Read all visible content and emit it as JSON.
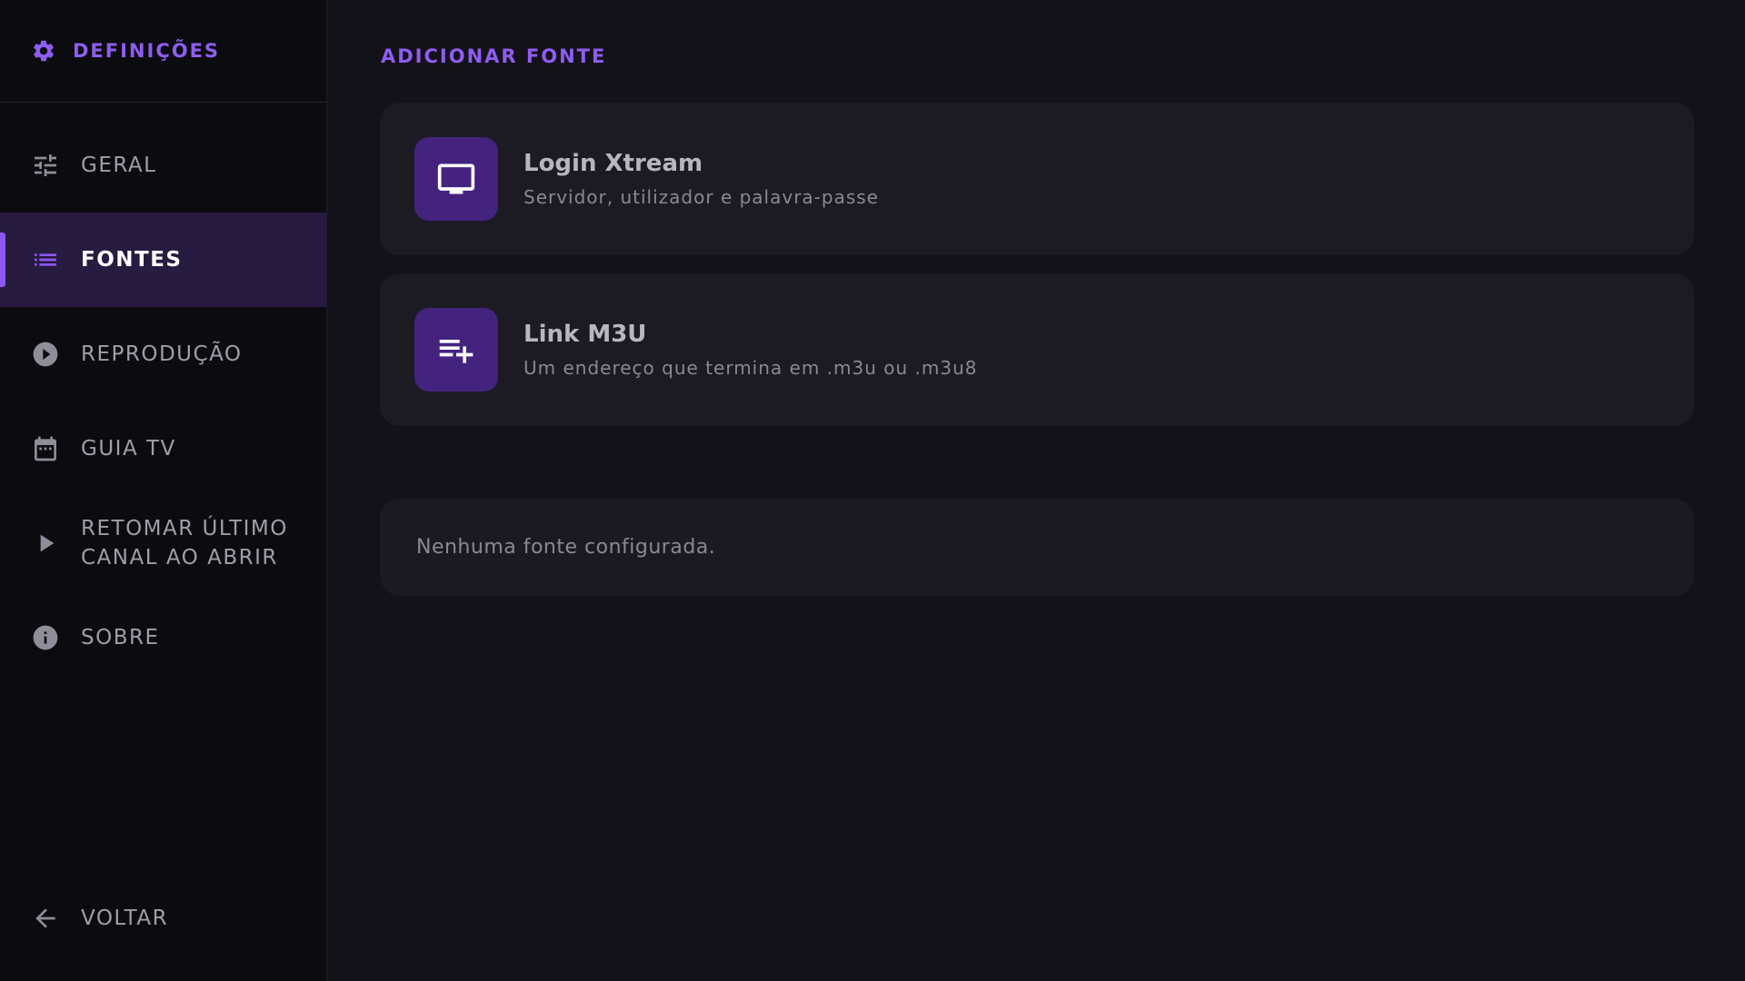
{
  "sidebar": {
    "title": "DEFINIÇÕES",
    "items": [
      {
        "label": "GERAL",
        "icon": "tune-icon"
      },
      {
        "label": "FONTES",
        "icon": "list-icon",
        "active": true
      },
      {
        "label": "REPRODUÇÃO",
        "icon": "play-circle-icon"
      },
      {
        "label": "GUIA TV",
        "icon": "calendar-icon"
      },
      {
        "label_line1": "RETOMAR ÚLTIMO",
        "label_line2": "CANAL AO ABRIR",
        "icon": "play-arrow-icon"
      },
      {
        "label": "SOBRE",
        "icon": "info-icon"
      }
    ],
    "back": {
      "label": "VOLTAR",
      "icon": "arrow-back-icon"
    }
  },
  "main": {
    "section_title": "ADICIONAR FONTE",
    "cards": [
      {
        "title": "Login Xtream",
        "subtitle": "Servidor, utilizador e palavra-passe",
        "icon": "tv-icon"
      },
      {
        "title": "Link M3U",
        "subtitle": "Um endereço que termina em .m3u ou .m3u8",
        "icon": "playlist-add-icon"
      }
    ],
    "empty_message": "Nenhuma fonte configurada."
  },
  "colors": {
    "accent": "#8f5df0",
    "active_bg": "#271b40",
    "icon_tile": "#44237f",
    "card_bg": "#1c1b23",
    "page_bg": "#131219",
    "sidebar_bg": "#0c0b10"
  }
}
